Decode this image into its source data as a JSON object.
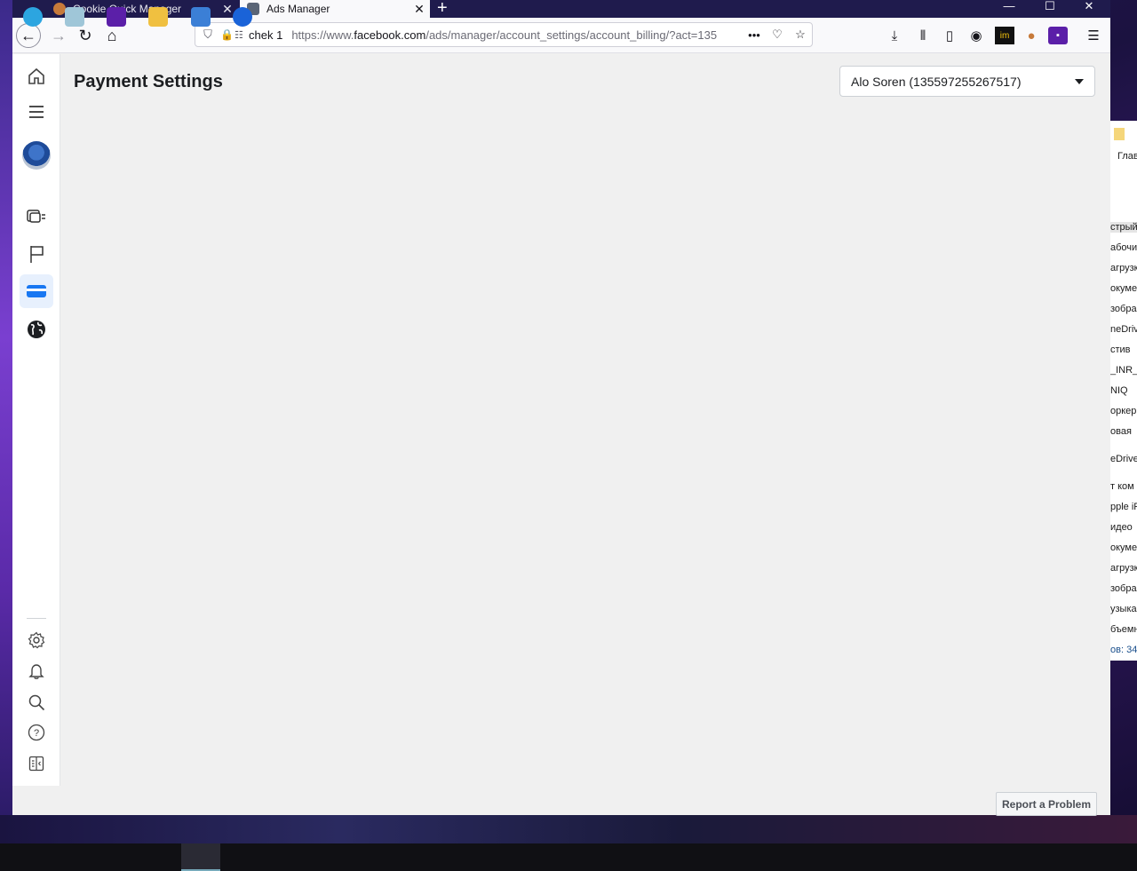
{
  "browser": {
    "tabs": [
      {
        "label": "Cookie Quick Manager",
        "active": false
      },
      {
        "label": "Ads Manager",
        "active": true
      }
    ],
    "url_container": "chek 1",
    "url_prefix": "https://www.",
    "url_domain": "facebook.com",
    "url_path": "/ads/manager/account_settings/account_billing/?act=135"
  },
  "sidebar": {
    "items": [
      {
        "name": "home-icon"
      },
      {
        "name": "menu-icon"
      },
      {
        "name": "avatar"
      },
      {
        "name": "campaigns-icon"
      },
      {
        "name": "flag-icon"
      },
      {
        "name": "billing-card-icon",
        "active": true
      },
      {
        "name": "globe-icon"
      },
      {
        "name": "settings-icon"
      },
      {
        "name": "notifications-icon"
      },
      {
        "name": "search-icon"
      },
      {
        "name": "help-icon"
      },
      {
        "name": "collapse-panel-icon"
      }
    ]
  },
  "main": {
    "title": "Payment Settings",
    "account_selector": "Alo Soren (135597255267517)",
    "report_button": "Report a Problem"
  },
  "explorer": {
    "rows": [
      "стрый",
      "абочи",
      "агрузк",
      "окуме",
      "зобра",
      "neDriv",
      "стив",
      "_INR_",
      "NIQ",
      "оркер",
      "овая",
      "eDrive",
      "т ком",
      "pple iF",
      "идео",
      "окуме",
      "агрузк",
      "зобра",
      "узыка",
      "бъемн",
      "ов: 34"
    ],
    "header": "Глав"
  },
  "colors": {
    "accent": "#1877f2",
    "active_bg": "#e7f0fd"
  }
}
